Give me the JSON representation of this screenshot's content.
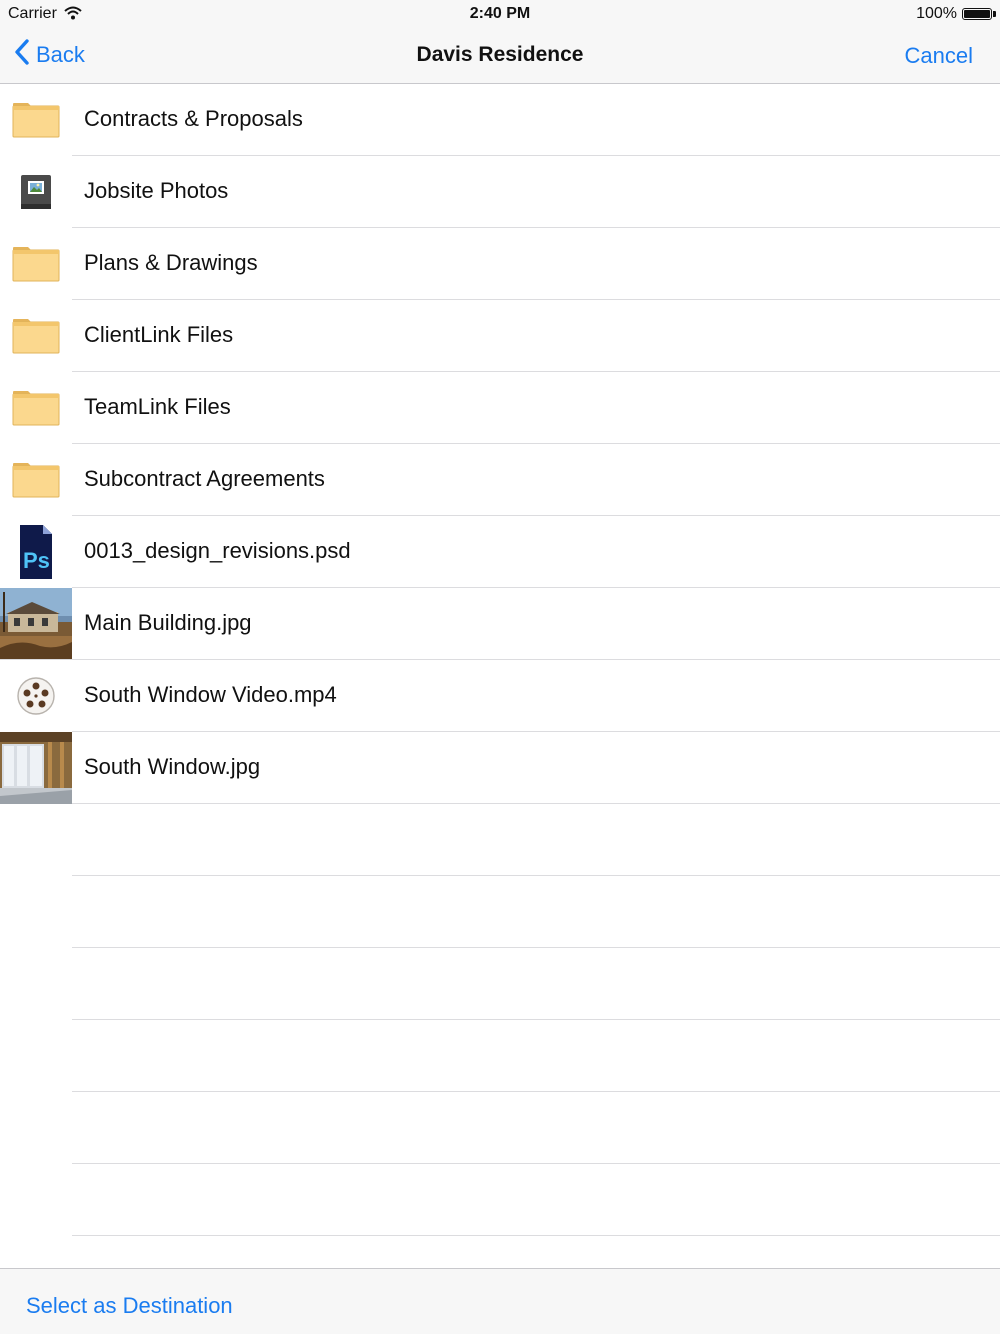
{
  "status_bar": {
    "carrier": "Carrier",
    "time": "2:40 PM",
    "battery": "100%"
  },
  "nav": {
    "back_label": "Back",
    "title": "Davis Residence",
    "cancel_label": "Cancel"
  },
  "items": [
    {
      "label": "Contracts & Proposals",
      "icon": "folder-icon"
    },
    {
      "label": "Jobsite Photos",
      "icon": "photo-album-icon"
    },
    {
      "label": "Plans & Drawings",
      "icon": "folder-icon"
    },
    {
      "label": "ClientLink Files",
      "icon": "folder-icon"
    },
    {
      "label": "TeamLink Files",
      "icon": "folder-icon"
    },
    {
      "label": "Subcontract Agreements",
      "icon": "folder-icon"
    },
    {
      "label": "0013_design_revisions.psd",
      "icon": "photoshop-file-icon"
    },
    {
      "label": "Main Building.jpg",
      "icon": "image-thumbnail"
    },
    {
      "label": "South Window Video.mp4",
      "icon": "film-reel-icon"
    },
    {
      "label": "South Window.jpg",
      "icon": "image-thumbnail"
    }
  ],
  "toolbar": {
    "select_label": "Select as Destination"
  },
  "colors": {
    "accent": "#1a7cf0",
    "folder": "#fbd88e",
    "separator": "#dcdcdf"
  }
}
